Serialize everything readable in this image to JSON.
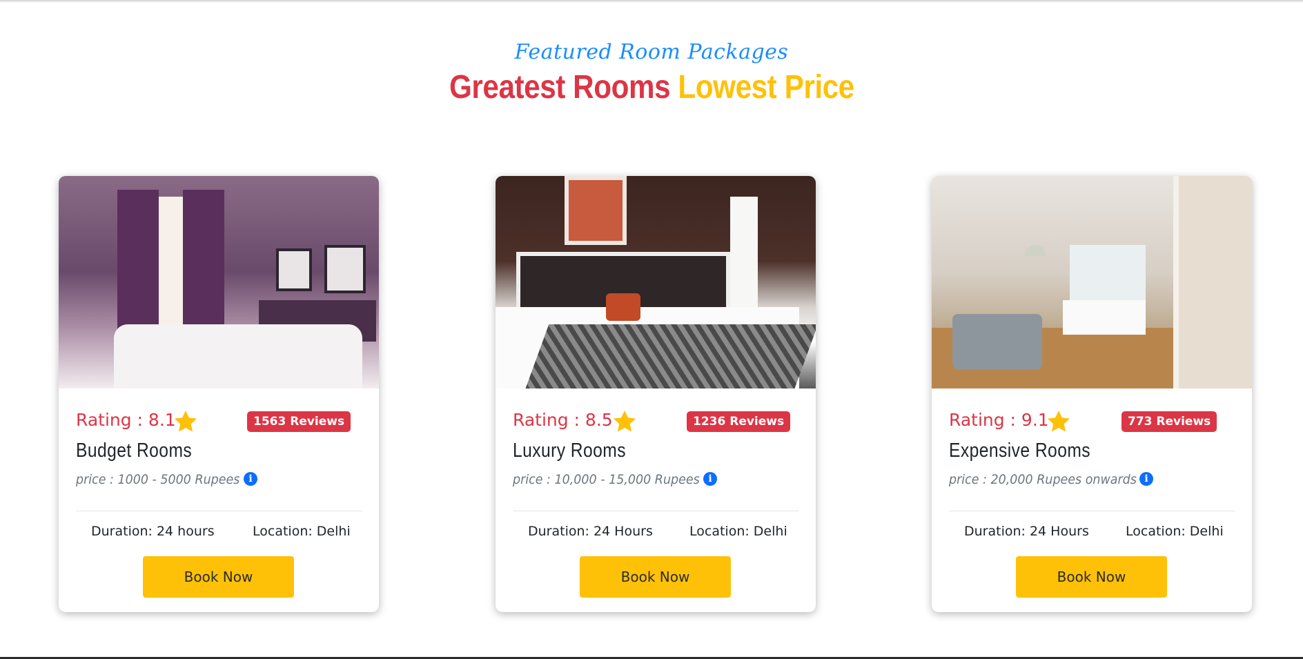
{
  "header": {
    "subtitle": "Featured Room Packages",
    "title_part1": "Greatest Rooms",
    "title_part2": "Lowest Price"
  },
  "colors": {
    "accent_red": "#dc3545",
    "accent_yellow": "#ffc107",
    "accent_blue": "#1a8cff",
    "info_blue": "#0d6efd"
  },
  "cards": [
    {
      "rating": "Rating : 8.1",
      "reviews": "1563 Reviews",
      "name": "Budget Rooms",
      "price": "price : 1000 - 5000 Rupees",
      "duration": "Duration: 24 hours",
      "location": "Location: Delhi",
      "button": "Book Now",
      "icon": "star-icon"
    },
    {
      "rating": "Rating : 8.5",
      "reviews": "1236 Reviews",
      "name": "Luxury Rooms",
      "price": "price : 10,000 - 15,000 Rupees",
      "duration": "Duration: 24 Hours",
      "location": "Location: Delhi",
      "button": "Book Now",
      "icon": "star-icon"
    },
    {
      "rating": "Rating : 9.1",
      "reviews": "773 Reviews",
      "name": "Expensive Rooms",
      "price": "price : 20,000 Rupees onwards",
      "duration": "Duration: 24 Hours",
      "location": "Location: Delhi",
      "button": "Book Now",
      "icon": "star-icon"
    }
  ]
}
